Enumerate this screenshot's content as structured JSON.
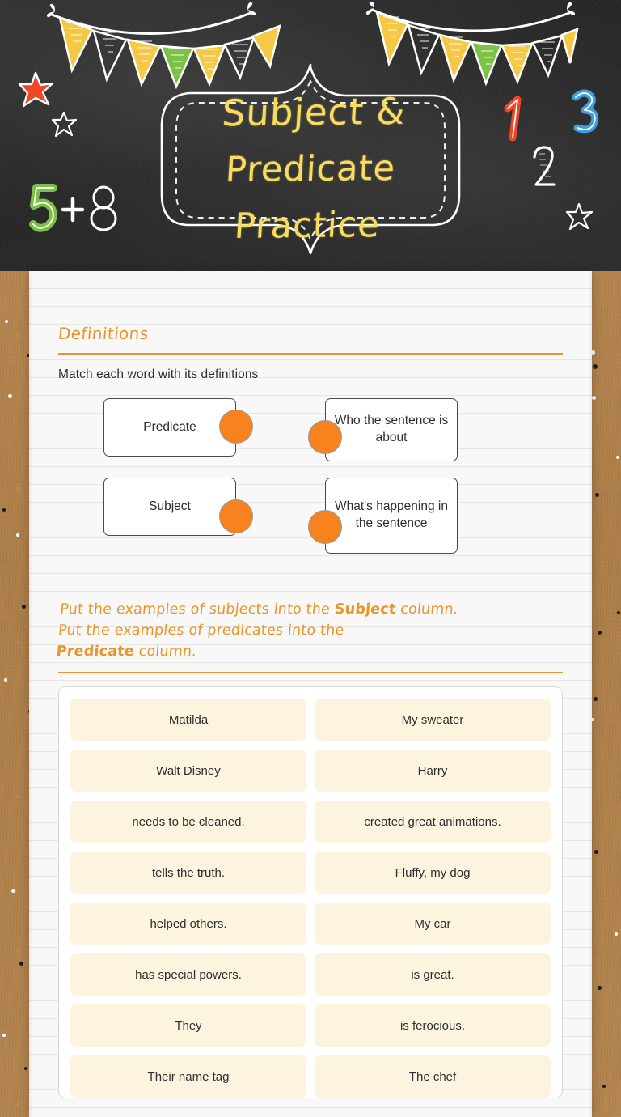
{
  "header": {
    "title_line1": "Subject &",
    "title_line2": "Predicate Practice",
    "decorations": [
      "bunting-left",
      "bunting-right",
      "star-red",
      "star-white-small",
      "star-white-right",
      "number-5-green",
      "plus-white",
      "number-8-white",
      "number-1-red",
      "number-2-white",
      "number-3-blue"
    ],
    "colors": {
      "chalkboard": "#2b2b2b",
      "title_yellow": "#f7dc5e",
      "flag_yellow": "#f5c842",
      "flag_green": "#79c143",
      "star_red": "#ee4323",
      "number_blue": "#3c9ede",
      "number_green": "#79c143",
      "number_red": "#ee4323"
    }
  },
  "definitions": {
    "heading": "Definitions",
    "prompt": "Match each word with its definitions",
    "accent_color": "#e8952b",
    "dot_color": "#f7821e",
    "pairs": [
      {
        "term": "Predicate",
        "definition": "Who the sentence is about"
      },
      {
        "term": "Subject",
        "definition": "What's happening in the sentence"
      }
    ]
  },
  "instructions": {
    "line1_a": "Put the examples of subjects into the ",
    "line1_bold": "Subject",
    "line1_b": " column.",
    "line2_a": "Put the examples of predicates into the ",
    "line2_bold": "Predicate",
    "line2_b": " column."
  },
  "wordbank": {
    "tile_color": "#fdf4e0",
    "tiles": [
      "Matilda",
      "My sweater",
      "Walt Disney",
      "Harry",
      "needs to be cleaned.",
      "created great animations.",
      "tells the truth.",
      "Fluffy, my dog",
      "helped others.",
      "My car",
      "has special powers.",
      "is great.",
      "They",
      "is ferocious.",
      "Their name tag",
      "The chef"
    ]
  }
}
